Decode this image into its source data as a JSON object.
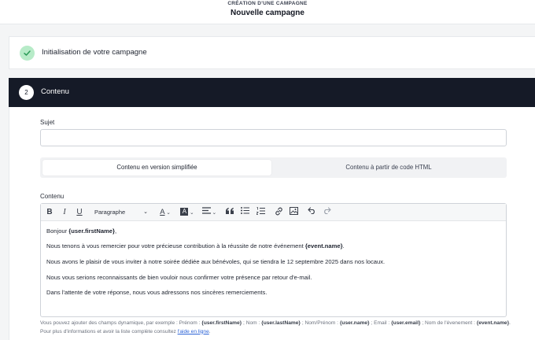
{
  "header": {
    "kicker": "CRÉATION D'UNE CAMPAGNE",
    "title": "Nouvelle campagne"
  },
  "steps": [
    {
      "label": "Initialisation de votre campagne",
      "status": "done",
      "icon": "check-icon"
    },
    {
      "number": "2",
      "label": "Contenu",
      "status": "active"
    }
  ],
  "form": {
    "subject_label": "Sujet",
    "subject_value": "",
    "tabs": [
      {
        "label": "Contenu en version simplifiée",
        "active": true
      },
      {
        "label": "Contenu à partir de code HTML",
        "active": false
      }
    ],
    "content_label": "Contenu"
  },
  "toolbar": {
    "bold": "B",
    "italic": "I",
    "underline": "U",
    "paragraph": "Paragraphe",
    "text_color": "A",
    "highlight": "A",
    "icons": [
      "align-icon",
      "quote-icon",
      "bullet-list-icon",
      "numbered-list-icon",
      "link-icon",
      "image-icon",
      "undo-icon",
      "redo-icon"
    ]
  },
  "body": {
    "greeting": "Bonjour ",
    "greeting_var": "{user.firstName}",
    "greeting_end": ",",
    "p1": "Nous tenons à vous remercier pour votre précieuse contribution à la réussite de notre événement ",
    "p1_var": "{event.name}",
    "p1_end": ".",
    "p2": "Nous avons le plaisir de vous inviter à notre soirée dédiée aux bénévoles, qui se tiendra le 12 septembre 2025 dans nos locaux.",
    "p3": "Nous vous serions reconnaissants de bien vouloir nous confirmer votre présence par retour d'e-mail.",
    "p4": "Dans l'attente de votre réponse, nous vous adressons nos sincères remerciements."
  },
  "help": {
    "intro": "Vous pouvez ajouter des champs dynamique, par exemple : Prénom : ",
    "firstname": "{user.firstName}",
    "nom_label": " ; Nom : ",
    "lastname": "{user.lastName}",
    "fullname_label": " ; Nom/Prénom : ",
    "fullname": "{user.name}",
    "email_label": " ; Email : ",
    "email": "{user.email}",
    "event_label": " ; Nom de l'évenement : ",
    "event": "{event.name}",
    "more": ". Pour plus d'informations et avoir la liste complète consultez ",
    "link": "l'aide en ligne",
    "end": "."
  },
  "colors": {
    "dark_header": "#151a27",
    "success_circle": "#b7ebc8",
    "link": "#2c63d6"
  }
}
